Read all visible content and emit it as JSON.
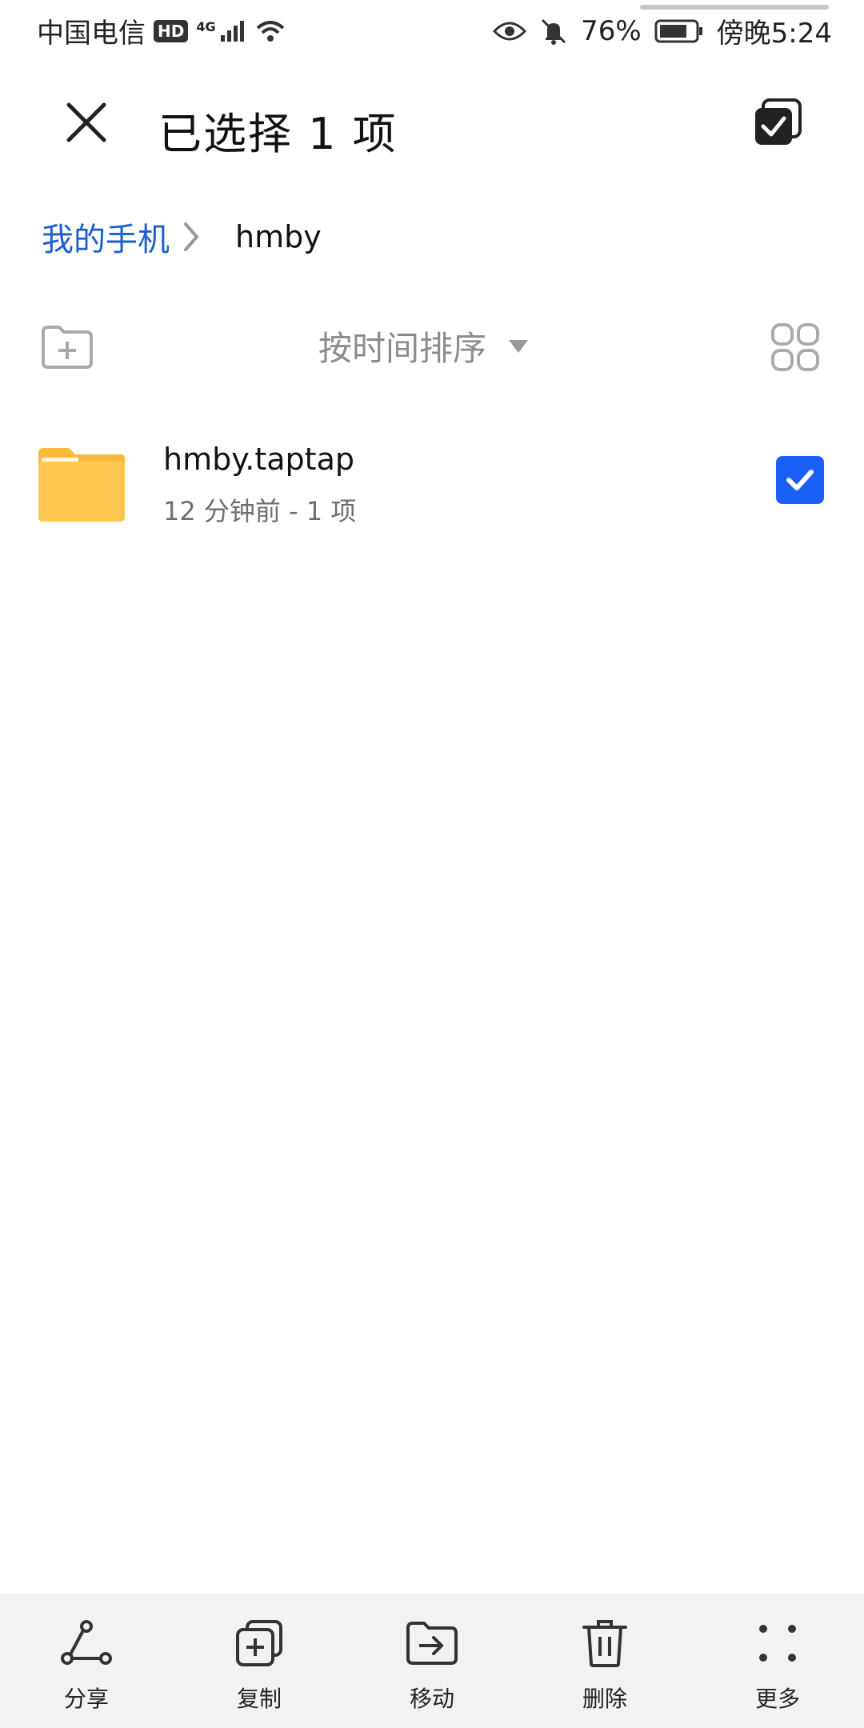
{
  "status_bar": {
    "carrier": "中国电信",
    "hd": "HD",
    "network": "4G",
    "battery": "76%",
    "time": "傍晚5:24"
  },
  "header": {
    "title": "已选择 1 项",
    "close_icon": "close-icon",
    "select_all_icon": "select-all-icon"
  },
  "breadcrumb": {
    "root": "我的手机",
    "current": "hmby"
  },
  "toolbar": {
    "sort_label": "按时间排序",
    "new_folder_icon": "new-folder-icon",
    "grid_view_icon": "grid-view-icon"
  },
  "files": [
    {
      "name": "hmby.taptap",
      "meta": "12 分钟前 - 1 项",
      "selected": true
    }
  ],
  "bottom_bar": {
    "items": [
      {
        "label": "分享",
        "icon": "share-icon"
      },
      {
        "label": "复制",
        "icon": "copy-icon"
      },
      {
        "label": "移动",
        "icon": "move-icon"
      },
      {
        "label": "删除",
        "icon": "delete-icon"
      },
      {
        "label": "更多",
        "icon": "more-icon"
      }
    ]
  },
  "colors": {
    "accent": "#1a5fd0",
    "checkbox": "#1a5ff5",
    "folder": "#fdc74f",
    "bottom_bar_bg": "#f2f2f2"
  }
}
